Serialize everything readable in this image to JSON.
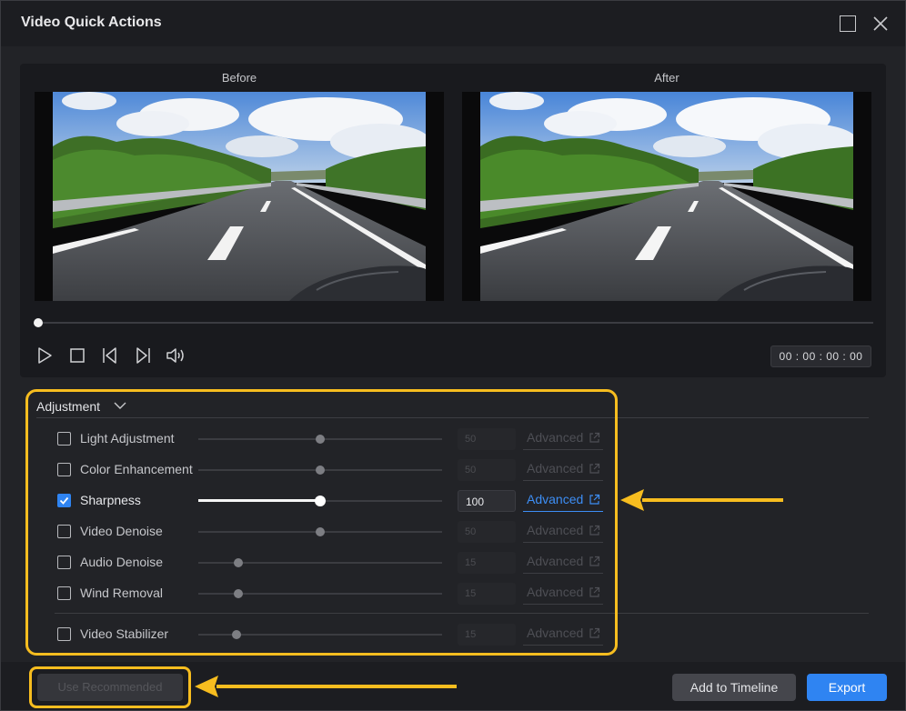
{
  "window": {
    "title": "Video Quick Actions"
  },
  "preview": {
    "before_label": "Before",
    "after_label": "After",
    "timecode": "00 : 00 : 00 : 00",
    "progress": 0
  },
  "adjustment": {
    "header": "Adjustment",
    "items": [
      {
        "label": "Light Adjustment",
        "checked": false,
        "value": "50",
        "level": 0.5,
        "advanced": "Advanced"
      },
      {
        "label": "Color Enhancement",
        "checked": false,
        "value": "50",
        "level": 0.5,
        "advanced": "Advanced"
      },
      {
        "label": "Sharpness",
        "checked": true,
        "value": "100",
        "level": 0.5,
        "advanced": "Advanced"
      },
      {
        "label": "Video Denoise",
        "checked": false,
        "value": "50",
        "level": 0.5,
        "advanced": "Advanced"
      },
      {
        "label": "Audio Denoise",
        "checked": false,
        "value": "15",
        "level": 0.165,
        "advanced": "Advanced"
      },
      {
        "label": "Wind Removal",
        "checked": false,
        "value": "15",
        "level": 0.165,
        "advanced": "Advanced"
      }
    ],
    "stabilizer": {
      "label": "Video Stabilizer",
      "checked": false,
      "value": "15",
      "level": 0.155,
      "advanced": "Advanced"
    }
  },
  "footer": {
    "use_recommended": "Use Recommended",
    "add_to_timeline": "Add to Timeline",
    "export": "Export"
  },
  "colors": {
    "accent": "#2f84f2",
    "highlight": "#f7bd1f"
  }
}
